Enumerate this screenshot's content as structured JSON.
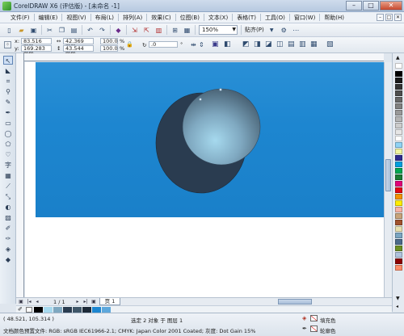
{
  "window": {
    "title": "CorelDRAW X6 (评估版) - [未命名 -1]"
  },
  "menu": {
    "items": [
      "文件(F)",
      "编辑(E)",
      "视图(V)",
      "布局(L)",
      "排列(A)",
      "效果(C)",
      "位图(B)",
      "文本(X)",
      "表格(T)",
      "工具(O)",
      "窗口(W)",
      "帮助(H)"
    ]
  },
  "toolbar": {
    "zoom": "150%",
    "snap": "贴齐(P)"
  },
  "propbar": {
    "x": "83.516 mm",
    "y": "169.283 mm",
    "width": "42.369 mm",
    "height": "43.544 mm",
    "scale_x": "100.0",
    "scale_y": "100.0",
    "pct": "%",
    "rotation": ".0",
    "x_label": "x:",
    "y_label": "y:"
  },
  "pagenav": {
    "page_count": "1 / 1",
    "page_tab": "页 1"
  },
  "status": {
    "coords": "( 48.521, 105.314 )",
    "selection": "选定 2 对象 于 图层 1",
    "color_profile": "文档颜色预置文件: RGB: sRGB IEC61966-2.1; CMYK: Japan Color 2001 Coated; 灰度: Dot Gain 15%",
    "fill_label": "填充色",
    "outline_label": "轮廓色"
  },
  "colors": {
    "page_background": "#1d86d0",
    "dark_circle": "#2a3c50",
    "light_circle_center": "#a6d9ee",
    "light_circle_edge": "#3f5668"
  }
}
